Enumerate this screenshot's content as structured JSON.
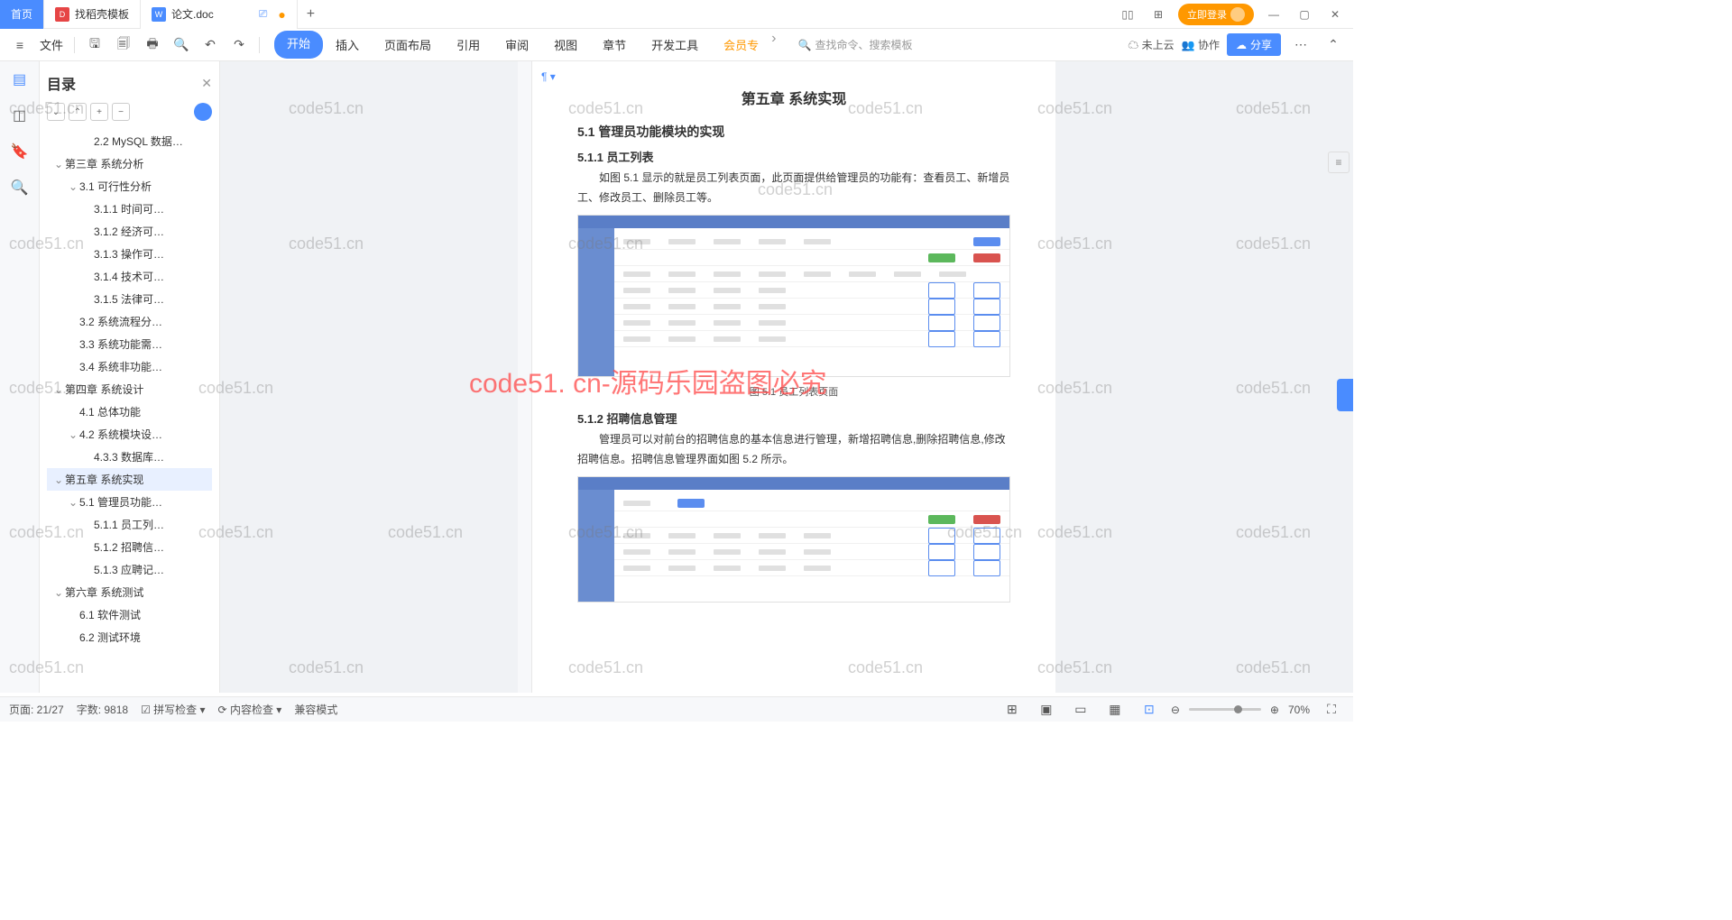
{
  "tabs": {
    "home": "首页",
    "template": "找稻壳模板",
    "doc": "论文.doc"
  },
  "login": "立即登录",
  "menubar": {
    "file": "文件",
    "start": "开始",
    "insert": "插入",
    "layout": "页面布局",
    "references": "引用",
    "review": "审阅",
    "view": "视图",
    "chapter": "章节",
    "devtools": "开发工具",
    "member": "会员专",
    "search": "查找命令、搜索模板"
  },
  "toolbar_right": {
    "cloud": "未上云",
    "collab": "协作",
    "share": "分享"
  },
  "outline": {
    "title": "目录",
    "items": [
      {
        "l": 3,
        "t": "2.2 MySQL 数据…"
      },
      {
        "l": 1,
        "t": "第三章  系统分析",
        "c": true
      },
      {
        "l": 2,
        "t": "3.1 可行性分析",
        "c": true
      },
      {
        "l": 3,
        "t": "3.1.1 时间可…"
      },
      {
        "l": 3,
        "t": "3.1.2 经济可…"
      },
      {
        "l": 3,
        "t": "3.1.3 操作可…"
      },
      {
        "l": 3,
        "t": "3.1.4 技术可…"
      },
      {
        "l": 3,
        "t": "3.1.5 法律可…"
      },
      {
        "l": 2,
        "t": "3.2 系统流程分…"
      },
      {
        "l": 2,
        "t": "3.3 系统功能需…"
      },
      {
        "l": 2,
        "t": "3.4 系统非功能…"
      },
      {
        "l": 1,
        "t": "第四章  系统设计",
        "c": true
      },
      {
        "l": 2,
        "t": "4.1 总体功能"
      },
      {
        "l": 2,
        "t": "4.2 系统模块设…",
        "c": true
      },
      {
        "l": 3,
        "t": "4.3.3 数据库…"
      },
      {
        "l": 1,
        "t": "第五章  系统实现",
        "c": true,
        "sel": true
      },
      {
        "l": 2,
        "t": "5.1 管理员功能…",
        "c": true
      },
      {
        "l": 3,
        "t": "5.1.1 员工列…"
      },
      {
        "l": 3,
        "t": "5.1.2 招聘信…"
      },
      {
        "l": 3,
        "t": "5.1.3 应聘记…"
      },
      {
        "l": 1,
        "t": "第六章  系统测试",
        "c": true
      },
      {
        "l": 2,
        "t": "6.1 软件测试"
      },
      {
        "l": 2,
        "t": "6.2 测试环境"
      }
    ]
  },
  "document": {
    "chapter_title": "第五章  系统实现",
    "h2_1": "5.1  管理员功能模块的实现",
    "h3_1": "5.1.1  员工列表",
    "p1": "如图 5.1 显示的就是员工列表页面，此页面提供给管理员的功能有：查看员工、新增员工、修改员工、删除员工等。",
    "caption1": "图 5.1 员工列表页面",
    "h3_2": "5.1.2  招聘信息管理",
    "p2": "管理员可以对前台的招聘信息的基本信息进行管理，新增招聘信息,删除招聘信息,修改招聘信息。招聘信息管理界面如图 5.2 所示。"
  },
  "statusbar": {
    "page": "页面: 21/27",
    "words": "字数: 9818",
    "spell": "拼写检查",
    "content": "内容检查",
    "compat": "兼容模式",
    "zoom": "70%"
  },
  "watermark": {
    "main": "code51. cn-源码乐园盗图必究",
    "small": "code51.cn"
  }
}
